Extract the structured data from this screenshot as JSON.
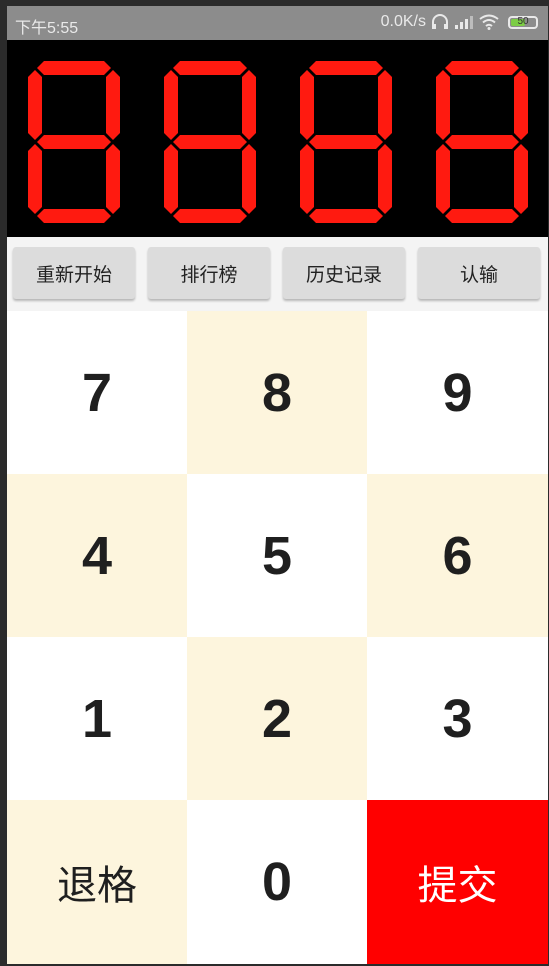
{
  "status_bar": {
    "time": "下午5:55",
    "net_speed": "0.0K/s",
    "battery_level": "50"
  },
  "display": {
    "digits": [
      {
        "segments": "abcdefg"
      },
      {
        "segments": "abcdefg"
      },
      {
        "segments": "abcdefg"
      },
      {
        "segments": "abcdefg"
      }
    ],
    "on_color": "#ff1a10",
    "off_color": "#2a0000"
  },
  "toolbar": {
    "buttons": [
      "重新开始",
      "排行榜",
      "历史记录",
      "认输"
    ]
  },
  "keypad": {
    "keys": [
      "7",
      "8",
      "9",
      "4",
      "5",
      "6",
      "1",
      "2",
      "3",
      "退格",
      "0",
      "提交"
    ],
    "colors": {
      "white": "#ffffff",
      "cream": "#fdf5dd",
      "submit": "#ff0000"
    }
  }
}
